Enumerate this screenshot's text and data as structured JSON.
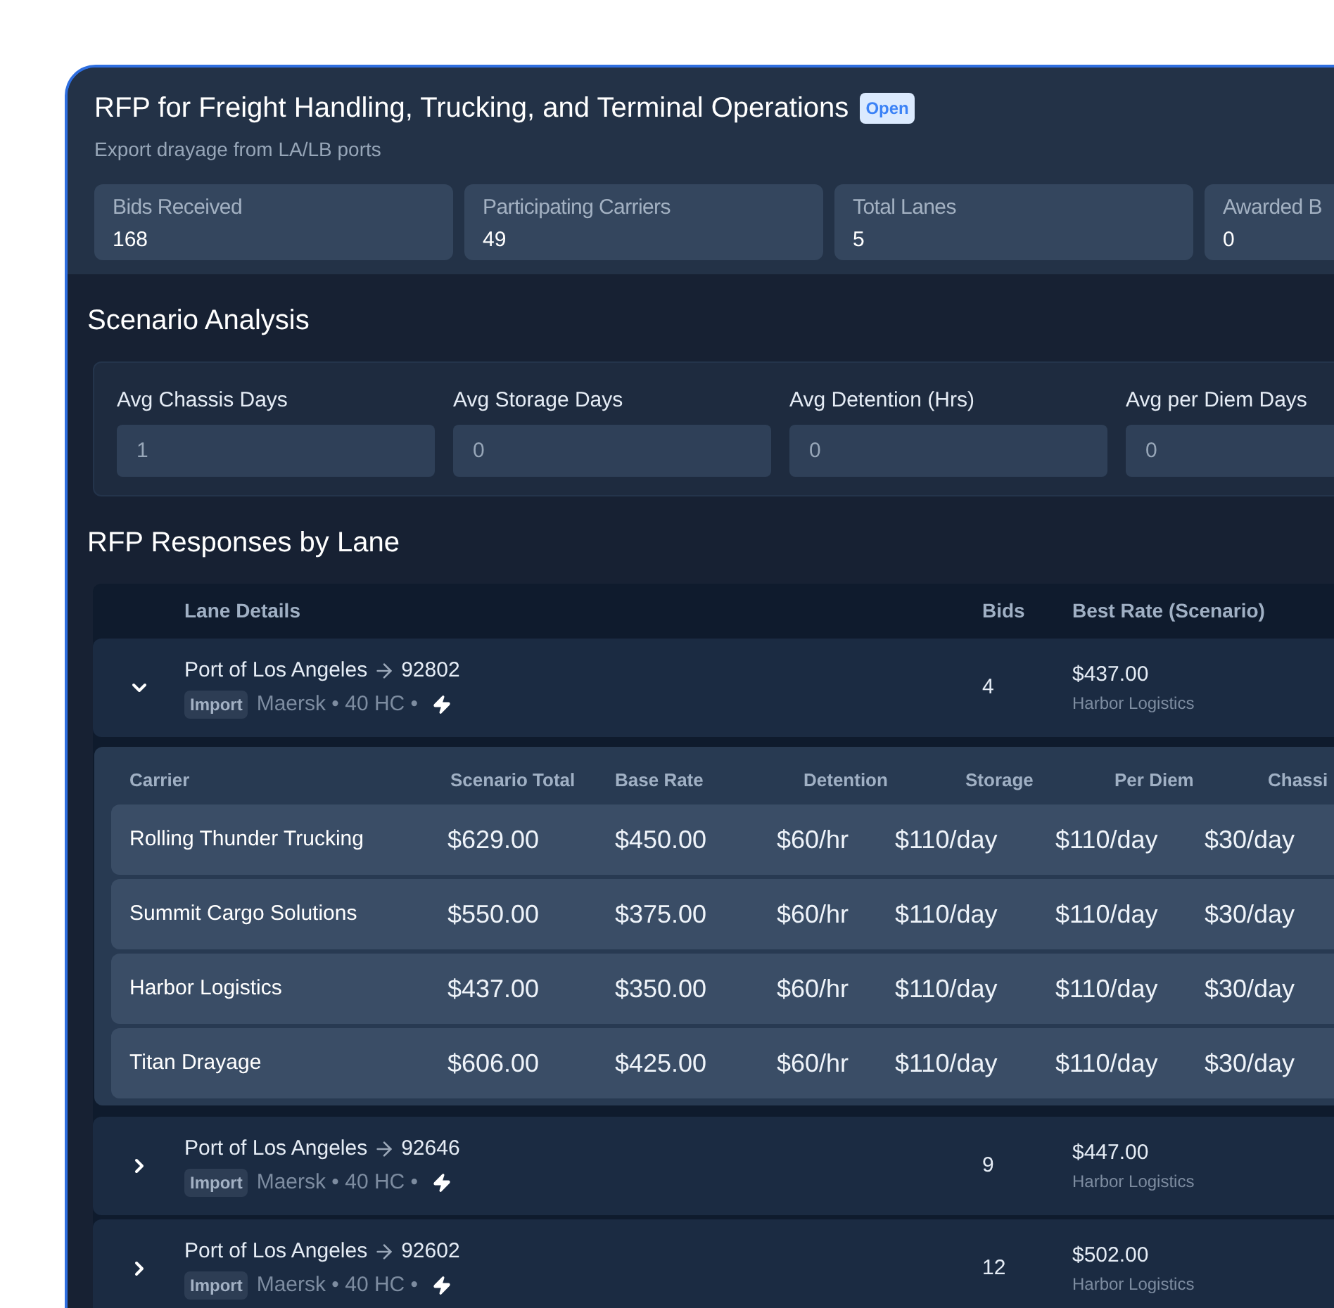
{
  "rfp": {
    "title": "RFP for Freight Handling, Trucking, and Terminal Operations",
    "status": "Open",
    "subtitle": "Export drayage from LA/LB ports"
  },
  "stats": [
    {
      "label": "Bids Received",
      "value": "168"
    },
    {
      "label": "Participating Carriers",
      "value": "49"
    },
    {
      "label": "Total Lanes",
      "value": "5"
    },
    {
      "label": "Awarded B",
      "value": "0"
    }
  ],
  "scenario": {
    "title": "Scenario Analysis",
    "fields": [
      {
        "label": "Avg Chassis Days",
        "value": "1"
      },
      {
        "label": "Avg Storage Days",
        "value": "0"
      },
      {
        "label": "Avg Detention (Hrs)",
        "value": "0"
      },
      {
        "label": "Avg per Diem Days",
        "value": "0"
      }
    ]
  },
  "responses": {
    "title": "RFP Responses by Lane",
    "columns": [
      "Lane Details",
      "Bids",
      "Best Rate (Scenario)"
    ],
    "bid_columns": [
      "Carrier",
      "Scenario Total",
      "Base Rate",
      "Detention",
      "Storage",
      "Per Diem",
      "Chassi"
    ],
    "lanes": [
      {
        "origin": "Port of Los Angeles",
        "destination": "92802",
        "type": "Import",
        "meta": "Maersk • 40 HC •",
        "bids": "4",
        "best_rate": "$437.00",
        "best_carrier": "Harbor Logistics",
        "expanded": true,
        "bid_rows": [
          {
            "carrier": "Rolling Thunder Trucking",
            "values": [
              "$629.00",
              "$450.00",
              "$60/hr",
              "$110/day",
              "$110/day",
              "$30/day"
            ]
          },
          {
            "carrier": "Summit Cargo Solutions",
            "values": [
              "$550.00",
              "$375.00",
              "$60/hr",
              "$110/day",
              "$110/day",
              "$30/day"
            ]
          },
          {
            "carrier": "Harbor Logistics",
            "values": [
              "$437.00",
              "$350.00",
              "$60/hr",
              "$110/day",
              "$110/day",
              "$30/day"
            ]
          },
          {
            "carrier": "Titan Drayage",
            "values": [
              "$606.00",
              "$425.00",
              "$60/hr",
              "$110/day",
              "$110/day",
              "$30/day"
            ]
          }
        ]
      },
      {
        "origin": "Port of Los Angeles",
        "destination": "92646",
        "type": "Import",
        "meta": "Maersk • 40 HC •",
        "bids": "9",
        "best_rate": "$447.00",
        "best_carrier": "Harbor Logistics",
        "expanded": false
      },
      {
        "origin": "Port of Los Angeles",
        "destination": "92602",
        "type": "Import",
        "meta": "Maersk • 40 HC •",
        "bids": "12",
        "best_rate": "$502.00",
        "best_carrier": "Harbor Logistics",
        "expanded": false
      }
    ]
  }
}
